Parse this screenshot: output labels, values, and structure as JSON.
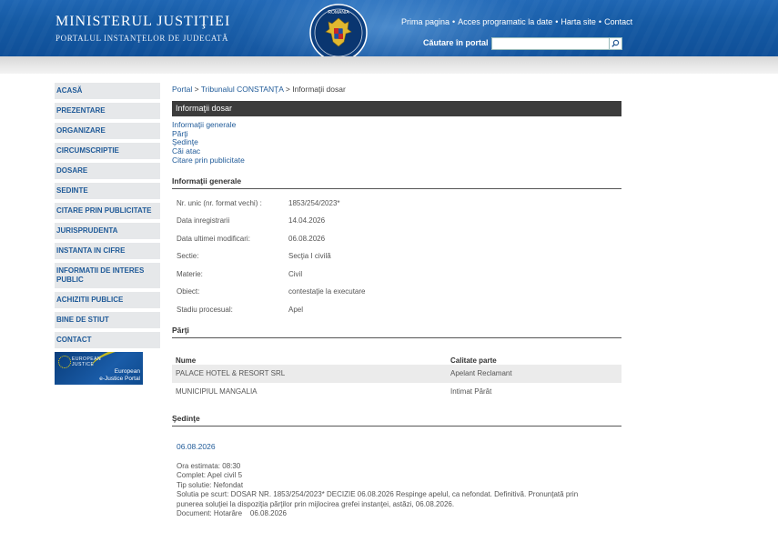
{
  "header": {
    "title": "MINISTERUL JUSTIŢIEI",
    "subtitle": "PORTALUL INSTANŢELOR DE JUDECATĂ",
    "emblem_label": "ROMÂNIA",
    "links": [
      "Prima pagina",
      "Acces programatic la date",
      "Harta site",
      "Contact"
    ],
    "search_label": "Căutare în portal",
    "search_value": ""
  },
  "sidebar": {
    "items": [
      "ACASĂ",
      "PREZENTARE",
      "ORGANIZARE",
      "CIRCUMSCRIPTIE",
      "DOSARE",
      "SEDINTE",
      "CITARE PRIN PUBLICITATE",
      "JURISPRUDENTA",
      "INSTANTA IN CIFRE",
      "INFORMATII DE INTERES PUBLIC",
      "ACHIZITII PUBLICE",
      "BINE DE STIUT",
      "CONTACT"
    ],
    "banner": {
      "logo_line1": "EUROPEAN",
      "logo_line2": "JUSTICE",
      "text_line1": "European",
      "text_line2": "e-Justice Portal"
    }
  },
  "breadcrumb": {
    "items": [
      "Portal",
      "Tribunalul CONSTANŢA"
    ],
    "current": "Informaţii dosar",
    "separator": ">"
  },
  "page_title": "Informaţii dosar",
  "quick_links": [
    "Informaţii generale",
    "Părţi",
    "Şedinţe",
    "Căi atac",
    "Citare prin publicitate"
  ],
  "general_info": {
    "heading": "Informaţii generale",
    "rows": [
      {
        "label": "Nr. unic (nr. format vechi) :",
        "value": "1853/254/2023*"
      },
      {
        "label": "Data inregistrarii",
        "value": "14.04.2026"
      },
      {
        "label": "Data ultimei modificari:",
        "value": "06.08.2026"
      },
      {
        "label": "Sectie:",
        "value": "Secţia I civilă"
      },
      {
        "label": "Materie:",
        "value": "Civil"
      },
      {
        "label": "Obiect:",
        "value": "contestaţie la executare"
      },
      {
        "label": "Stadiu procesual:",
        "value": "Apel"
      }
    ]
  },
  "parties": {
    "heading": "Părţi",
    "columns": [
      "Nume",
      "Calitate parte"
    ],
    "rows": [
      {
        "name": "PALACE HOTEL & RESORT SRL",
        "role": "Apelant Reclamant"
      },
      {
        "name": "MUNICIPIUL MANGALIA",
        "role": "Intimat Pârât"
      }
    ]
  },
  "sessions": {
    "heading": "Şedinţe",
    "date": "06.08.2026",
    "lines": [
      "Ora estimata: 08:30",
      "Complet: Apel civil 5",
      "Tip solutie: Nefondat",
      "Solutia pe scurt: DOSAR NR. 1853/254/2023* DECIZIE 06.08.2026 Respinge apelul, ca nefondat. Definitivă. Pronunţată prin",
      "punerea soluţiei la dispoziţia părţilor prin mijlocirea grefei instanţei, astăzi, 06.08.2026.",
      "Document: Hotarâre    06.08.2026"
    ]
  },
  "colors": {
    "header_blue": "#155aa4",
    "link_blue": "#1f5a98",
    "title_bar": "#3c3c3c",
    "nav_bg": "#e6e8ea"
  }
}
